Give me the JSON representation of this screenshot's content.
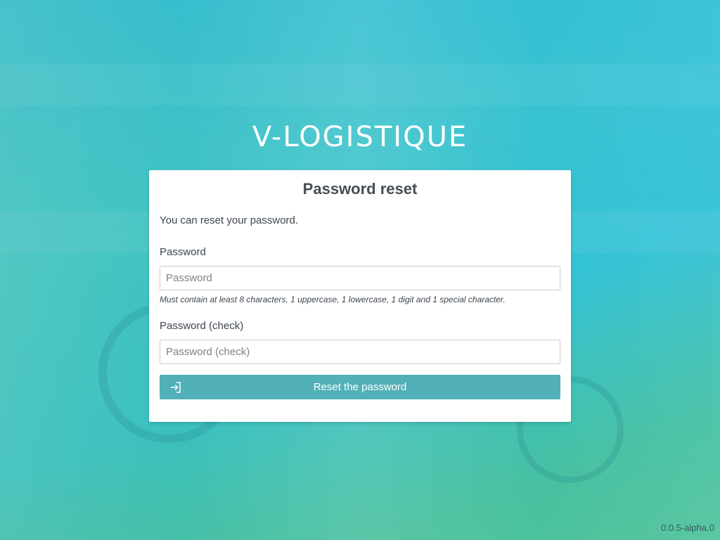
{
  "brand": {
    "logo_text": "V-LOGISTIQUE"
  },
  "form": {
    "title": "Password reset",
    "intro": "You can reset your password.",
    "password_label": "Password",
    "password_placeholder": "Password",
    "password_hint": "Must contain at least 8 characters, 1 uppercase, 1 lowercase, 1 digit and 1 special character.",
    "password_check_label": "Password (check)",
    "password_check_placeholder": "Password (check)",
    "submit_label": "Reset the password",
    "submit_icon": "login-arrow-icon"
  },
  "footer": {
    "version": "0.0.5-alpha.0"
  },
  "colors": {
    "accent": "#52b0b8",
    "text": "#3d464f",
    "card": "#ffffff"
  }
}
